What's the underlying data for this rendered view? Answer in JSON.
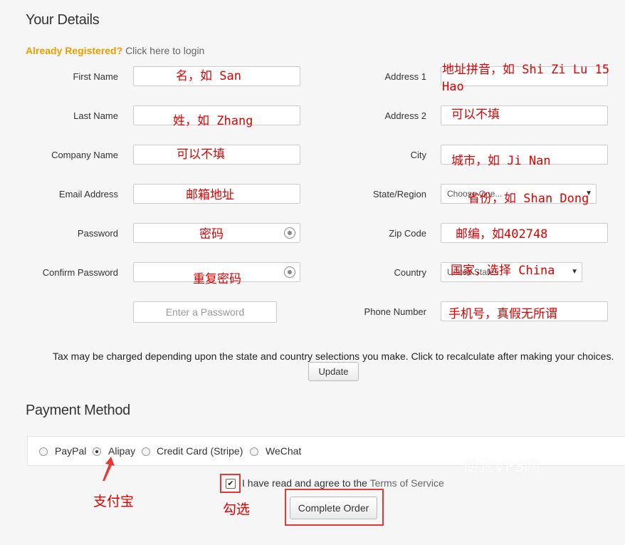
{
  "details": {
    "title": "Your Details",
    "already_registered": "Already Registered?",
    "login_link": "Click here to login"
  },
  "fields": {
    "first_name": "First Name",
    "last_name": "Last Name",
    "company_name": "Company Name",
    "email_address": "Email Address",
    "password": "Password",
    "confirm_password": "Confirm Password",
    "password_generator": "Enter a Password",
    "address1": "Address 1",
    "address2": "Address 2",
    "city": "City",
    "state_region": "State/Region",
    "state_value": "Choose One...",
    "zip_code": "Zip Code",
    "country": "Country",
    "country_value": "United States",
    "phone_number": "Phone Number"
  },
  "notes": {
    "first_name": "名，如 San",
    "last_name": "姓，如 Zhang",
    "company_name": "可以不填",
    "email": "邮箱地址",
    "password": "密码",
    "confirm_password": "重复密码",
    "address1": "地址拼音，如 Shi Zi Lu 15\nHao",
    "address2": "可以不填",
    "city": "城市，如 Ji Nan",
    "state": "省份，如 Shan Dong",
    "zip": "邮编，如402748",
    "country": "国家，选择 China",
    "phone": "手机号，真假无所谓",
    "alipay": "支付宝",
    "check": "勾选"
  },
  "tax": {
    "text": "Tax may be charged depending upon the state and country selections you make. Click to recalculate after making your choices.",
    "update_label": "Update"
  },
  "payment": {
    "title": "Payment Method",
    "options": [
      "PayPal",
      "Alipay",
      "Credit Card (Stripe)",
      "WeChat"
    ],
    "selected": "Alipay"
  },
  "agree": {
    "text": "I have read and agree to the",
    "tos_link": "Terms of Service",
    "checked": true
  },
  "complete_label": "Complete Order",
  "watermark": "便宜VPS网",
  "colors": {
    "annotation_red": "#e00000",
    "registered_orange": "#e8a000"
  }
}
